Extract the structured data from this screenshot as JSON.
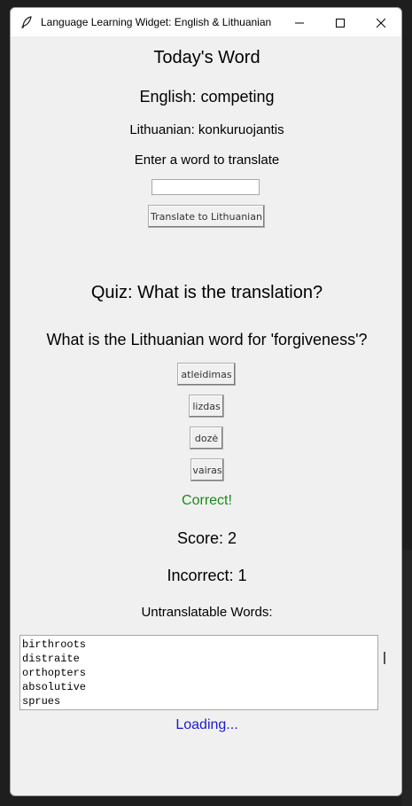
{
  "window": {
    "title": "Language Learning Widget: English & Lithuanian",
    "controls": {
      "minimize_icon": "minimize-icon",
      "maximize_icon": "maximize-icon",
      "close_icon": "close-icon"
    }
  },
  "word_of_day": {
    "heading": "Today's Word",
    "english": "English: competing",
    "lithuanian": "Lithuanian: konkuruojantis"
  },
  "translate": {
    "prompt": "Enter a word to translate",
    "input_value": "",
    "button_label": "Translate to Lithuanian"
  },
  "quiz": {
    "heading": "Quiz: What is the translation?",
    "question": "What is the Lithuanian word for 'forgiveness'?",
    "options": [
      "atleidimas",
      "lizdas",
      "dozė",
      "vairas"
    ],
    "feedback": "Correct!",
    "score": "Score: 2",
    "incorrect": "Incorrect: 1"
  },
  "untranslatable": {
    "label": "Untranslatable Words:",
    "words": [
      "birthroots",
      "distraite",
      "orthopters",
      "absolutive",
      "sprues"
    ]
  },
  "status": {
    "loading": "Loading..."
  },
  "colors": {
    "feedback_correct": "#1a8a1a",
    "loading_text": "#1a1acc",
    "window_bg": "#f0f0f0"
  }
}
